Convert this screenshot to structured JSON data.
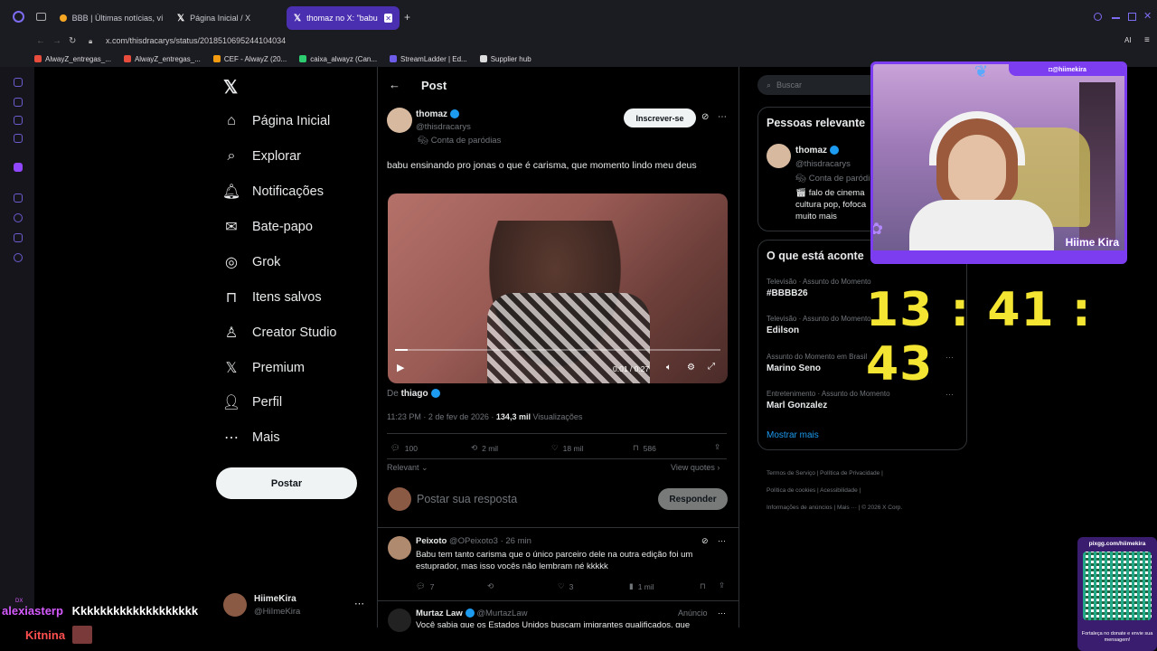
{
  "browser": {
    "tabs": [
      {
        "label": "BBB | Últimas notícias, víd"
      },
      {
        "label": "Página Inicial / X"
      },
      {
        "label": "thomaz no X: \"babu en"
      }
    ],
    "url": "x.com/thisdracarys/status/2018510695244104034",
    "bookmarks": [
      "AlwayZ_entregas_...",
      "AlwayZ_entregas_...",
      "CEF - AlwayZ (20...",
      "caixa_alwayz (Can...",
      "StreamLadder | Ed...",
      "Supplier hub"
    ],
    "ai_label": "AI"
  },
  "nav": {
    "items": [
      {
        "label": "Página Inicial",
        "icon": "home-icon"
      },
      {
        "label": "Explorar",
        "icon": "search-icon"
      },
      {
        "label": "Notificações",
        "icon": "bell-icon"
      },
      {
        "label": "Bate-papo",
        "icon": "mail-icon"
      },
      {
        "label": "Grok",
        "icon": "grok-icon"
      },
      {
        "label": "Itens salvos",
        "icon": "bookmark-icon"
      },
      {
        "label": "Creator Studio",
        "icon": "creator-icon"
      },
      {
        "label": "Premium",
        "icon": "x-icon"
      },
      {
        "label": "Perfil",
        "icon": "person-icon"
      },
      {
        "label": "Mais",
        "icon": "more-icon"
      }
    ],
    "post_button": "Postar",
    "account": {
      "name": "HiimeKira",
      "handle": "@HiImeKira"
    }
  },
  "post": {
    "header_title": "Post",
    "author_name": "thomaz",
    "author_handle": "@thisdracarys",
    "parody_label": "Conta de paródias",
    "subscribe_label": "Inscrever-se",
    "text": "babu ensinando pro jonas o que é carisma, que momento lindo meu deus",
    "video_time": "0:01 / 0:27",
    "from_prefix": "De",
    "from_user": "thiago",
    "timestamp": "11:23 PM · 2 de fev de 2026 ·",
    "views_count": "134,3 mil",
    "views_label": "Visualizações",
    "replies": "100",
    "reposts": "2 mil",
    "likes": "18 mil",
    "bookmarks": "586",
    "relevant_label": "Relevant",
    "view_quotes": "View quotes",
    "reply_placeholder": "Postar sua resposta",
    "reply_button": "Responder",
    "video_progress": 0.04
  },
  "replies": [
    {
      "name": "Peixoto",
      "handle": "@OPeixoto3 · 26 min",
      "text": "Babu tem tanto carisma que o único parceiro dele na outra edição foi um estuprador, mas isso vocês não lembram né kkkkk",
      "replies": "7",
      "likes": "3",
      "views": "1 mil"
    },
    {
      "name": "Murtaz Law",
      "handle": "@MurtazLaw",
      "ad_label": "Anúncio",
      "text": "Você sabia que os Estados Unidos buscam imigrantes qualificados, que"
    }
  ],
  "sidebar": {
    "search_placeholder": "Buscar",
    "relevant_title": "Pessoas relevante",
    "person": {
      "name": "thomaz",
      "handle": "@thisdracarys",
      "parody": "Conta de paródi",
      "bio1": "falo de cinema",
      "bio2": "cultura pop, fofoca",
      "bio3": "muito mais"
    },
    "trends_title": "O que está aconte",
    "trends": [
      {
        "meta": "Televisão · Assunto do Momento",
        "title": "#BBBB26"
      },
      {
        "meta": "Televisão · Assunto do Momento",
        "title": "Edilson"
      },
      {
        "meta": "Assunto do Momento em Brasil",
        "title": "Marino Seno"
      },
      {
        "meta": "Entretenimento · Assunto do Momento",
        "title": "Marl Gonzalez"
      }
    ],
    "show_more": "Mostrar mais",
    "footer": [
      "Termos de Serviço",
      "Política de Privacidade",
      "Política de cookies",
      "Acessibilidade",
      "Informações de anúncios",
      "Mais ···",
      "© 2026 X Corp."
    ]
  },
  "overlay": {
    "webcam_handle": "@hiimekira",
    "webcam_brand": "Hiime Kira",
    "clock": "13 : 41 : 43",
    "qr_url": "pixgg.com/hiimekira",
    "qr_caption": "Fortaleça no donate e envie sua mensagem!",
    "chat": [
      {
        "user": "alexiasterp",
        "message": "Kkkkkkkkkkkkkkkkkkk"
      },
      {
        "user": "Kitnina",
        "message": ""
      }
    ],
    "chat_tag": "DX"
  },
  "colors": {
    "accent": "#1d9bf0",
    "stream": "#7c3df0",
    "clock": "#f4e533"
  }
}
